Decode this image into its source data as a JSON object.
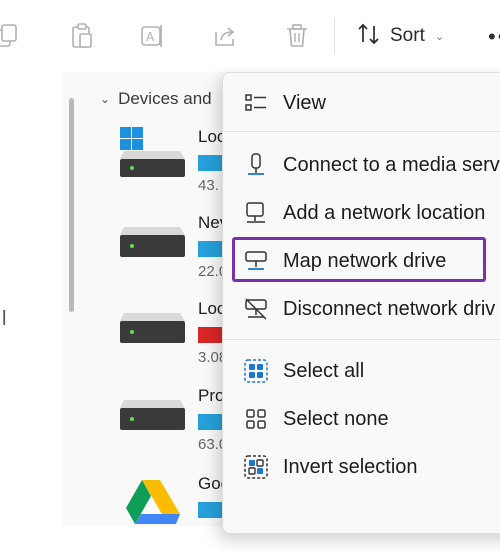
{
  "toolbar": {
    "icons": [
      "copy-icon",
      "paste-icon",
      "rename-icon",
      "share-icon",
      "delete-icon"
    ],
    "sort_label": "Sort",
    "sort_icon": "sort-arrows-icon",
    "more_glyph": "••"
  },
  "nav": {
    "partial_char": "l"
  },
  "content": {
    "group_header": "Devices and",
    "drives": [
      {
        "name": "Loc",
        "size": "43.",
        "bar_color": "#26a0da",
        "icon": "windows-drive-icon"
      },
      {
        "name": "Nev",
        "size": "22.0",
        "bar_color": "#26a0da",
        "icon": "drive-icon"
      },
      {
        "name": "Loc",
        "size": "3.08",
        "bar_color": "#da2626",
        "icon": "drive-icon"
      },
      {
        "name": "Pro",
        "size": "63.0",
        "bar_color": "#26a0da",
        "icon": "drive-icon"
      },
      {
        "name": "Goo",
        "size": "",
        "bar_color": "#26a0da",
        "icon": "google-drive-icon"
      }
    ]
  },
  "context_menu": {
    "items": [
      {
        "label": "View",
        "icon": "view-list-icon"
      },
      {
        "label": "Connect to a media serv",
        "icon": "media-server-icon"
      },
      {
        "label": "Add a network location",
        "icon": "network-location-icon"
      },
      {
        "label": "Map network drive",
        "icon": "map-network-drive-icon",
        "highlighted": true
      },
      {
        "label": "Disconnect network driv",
        "icon": "disconnect-network-drive-icon"
      },
      {
        "label": "Select all",
        "icon": "select-all-icon"
      },
      {
        "label": "Select none",
        "icon": "select-none-icon"
      },
      {
        "label": "Invert selection",
        "icon": "invert-selection-icon"
      }
    ],
    "highlight_color": "#7b2fa8"
  }
}
